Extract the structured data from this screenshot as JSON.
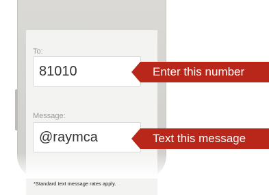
{
  "form": {
    "to_label": "To:",
    "to_value": "81010",
    "message_label": "Message:",
    "message_value": "@raymca"
  },
  "callouts": {
    "number_text": "Enter this number",
    "message_text": "Text this message"
  },
  "footer": {
    "disclaimer": "*Standard text message rates apply."
  },
  "colors": {
    "callout_red": "#b8271a",
    "phone_body": "#d6d5d1",
    "screen_bg": "#f3f3f2"
  }
}
